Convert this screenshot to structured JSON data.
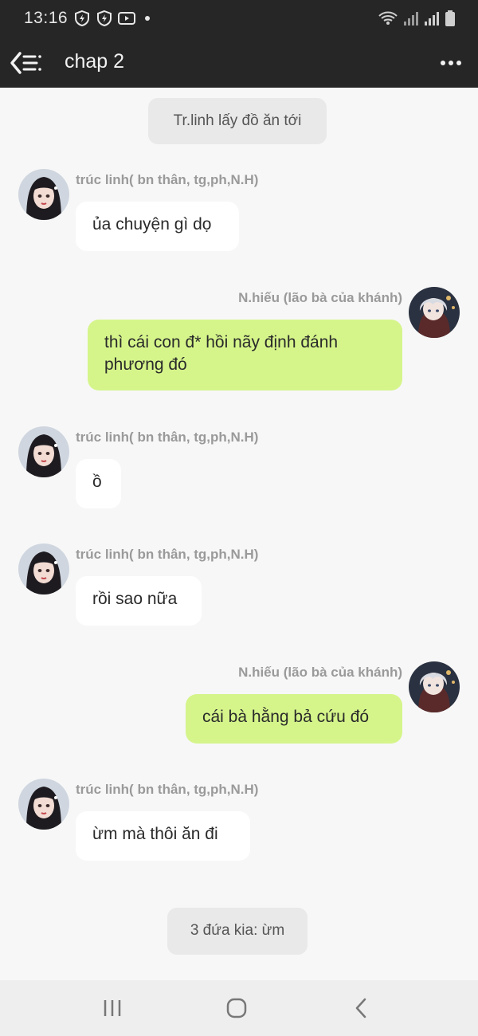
{
  "status_bar": {
    "time": "13:16"
  },
  "header": {
    "title": "chap 2"
  },
  "messages": [
    {
      "type": "system",
      "text": "Tr.linh lấy đồ ăn tới"
    },
    {
      "type": "incoming",
      "sender": "trúc linh( bn thân, tg,ph,N.H)",
      "text": "ủa chuyện gì dọ"
    },
    {
      "type": "outgoing",
      "sender": "N.hiếu (lão bà của khánh)",
      "text": "thì cái con đ* hồi nãy định đánh phương đó"
    },
    {
      "type": "incoming",
      "sender": "trúc linh( bn thân, tg,ph,N.H)",
      "text": "ồ"
    },
    {
      "type": "incoming",
      "sender": "trúc linh( bn thân, tg,ph,N.H)",
      "text": "rồi sao nữa"
    },
    {
      "type": "outgoing",
      "sender": "N.hiếu (lão bà của khánh)",
      "text": "cái bà hằng bả cứu đó"
    },
    {
      "type": "incoming",
      "sender": "trúc linh( bn thân, tg,ph,N.H)",
      "text": "ừm mà thôi ăn đi"
    },
    {
      "type": "system",
      "text": "3 đứa kia: ừm"
    }
  ]
}
